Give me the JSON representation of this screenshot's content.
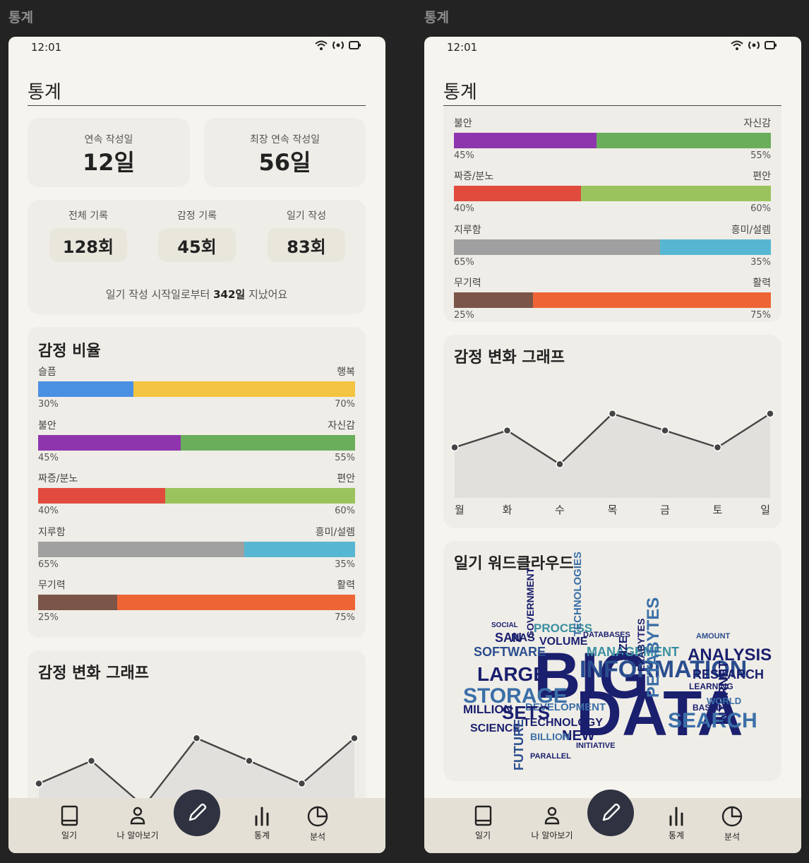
{
  "screens": [
    {
      "label": "통계",
      "status_time": "12:01",
      "page_title": "통계",
      "streak": [
        {
          "label": "연속 작성일",
          "value": "12일"
        },
        {
          "label": "최장 연속 작성일",
          "value": "56일"
        }
      ],
      "counts": [
        {
          "label": "전체 기록",
          "value": "128회"
        },
        {
          "label": "감정 기록",
          "value": "45회"
        },
        {
          "label": "일기 작성",
          "value": "83회"
        }
      ],
      "since": {
        "prefix": "일기 작성 시작일로부터",
        "days": "342일",
        "suffix": "지났어요"
      },
      "ratio_title": "감정 비율",
      "graph_title": "감정 변화 그래프"
    },
    {
      "label": "통계",
      "status_time": "12:01",
      "page_title": "통계",
      "graph_title": "감정 변화 그래프",
      "wordcloud_title": "일기 워드클라우드"
    }
  ],
  "emotion_ratios": [
    {
      "left": "슬픔",
      "right": "행복",
      "left_pct": 30,
      "right_pct": 70,
      "left_label": "30%",
      "right_label": "70%",
      "left_color": "#4a90e2",
      "right_color": "#f3c441"
    },
    {
      "left": "불안",
      "right": "자신감",
      "left_pct": 45,
      "right_pct": 55,
      "left_label": "45%",
      "right_label": "55%",
      "left_color": "#8e35ae",
      "right_color": "#6aae5c"
    },
    {
      "left": "짜증/분노",
      "right": "편안",
      "left_pct": 40,
      "right_pct": 60,
      "left_label": "40%",
      "right_label": "60%",
      "left_color": "#e04b3e",
      "right_color": "#9bc35d"
    },
    {
      "left": "지루함",
      "right": "흥미/설렘",
      "left_pct": 65,
      "right_pct": 35,
      "left_label": "65%",
      "right_label": "35%",
      "left_color": "#a0a0a0",
      "right_color": "#57b7d3"
    },
    {
      "left": "무기력",
      "right": "활력",
      "left_pct": 25,
      "right_pct": 75,
      "left_label": "25%",
      "right_label": "75%",
      "left_color": "#7a5548",
      "right_color": "#ee6535"
    }
  ],
  "chart_data": {
    "type": "area",
    "categories": [
      "월",
      "화",
      "수",
      "목",
      "금",
      "토",
      "일"
    ],
    "values": [
      3,
      4,
      2,
      5,
      4,
      3,
      5
    ],
    "ylim": [
      0,
      6.5
    ]
  },
  "nav": {
    "items": [
      {
        "label": "일기",
        "icon": "book-icon"
      },
      {
        "label": "나 알아보기",
        "icon": "person-icon"
      },
      {
        "label": "통계",
        "icon": "bar-chart-icon"
      },
      {
        "label": "분석",
        "icon": "pie-chart-icon"
      }
    ],
    "fab_icon": "pencil-icon"
  },
  "wordcloud": {
    "words": [
      "BIG",
      "DATA",
      "INFORMATION",
      "STORAGE",
      "LARGE",
      "SEARCH",
      "ANALYSIS",
      "SOFTWARE",
      "MANAGEMENT",
      "DEVELOPMENT",
      "TECHNOLOGY",
      "PETABYTES",
      "RESEARCH",
      "SETS",
      "MILLION",
      "SCIENCE",
      "PROCESS",
      "VOLUME",
      "GOVERNMENT",
      "TECHNOLOGIES",
      "INTERNET",
      "FUTURE",
      "NEW",
      "BILLION",
      "SAN",
      "NAS",
      "SIZE",
      "EXABYTES",
      "WORLD",
      "LEARNING",
      "BASED",
      "AMOUNT",
      "SOCIAL",
      "PARALLEL",
      "INITIATIVE",
      "DATABASES"
    ]
  }
}
